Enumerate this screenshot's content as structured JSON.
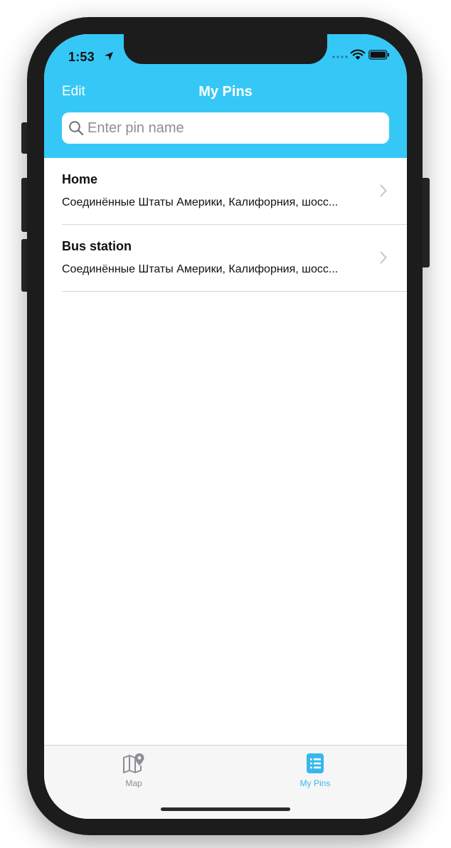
{
  "status_bar": {
    "time": "1:53",
    "location_icon": "location-arrow-icon",
    "wifi_icon": "wifi-icon",
    "battery_icon": "battery-icon"
  },
  "nav": {
    "edit_label": "Edit",
    "title": "My Pins"
  },
  "search": {
    "placeholder": "Enter pin name",
    "value": "",
    "icon": "search-icon"
  },
  "pins": [
    {
      "title": "Home",
      "address": "Соединённые Штаты Америки, Калифорния, шосс..."
    },
    {
      "title": "Bus station",
      "address": "Соединённые Штаты Америки, Калифорния, шосс..."
    }
  ],
  "tab_bar": {
    "tabs": [
      {
        "label": "Map",
        "icon": "map-pin-icon",
        "selected": false
      },
      {
        "label": "My Pins",
        "icon": "list-icon",
        "selected": true
      }
    ]
  },
  "colors": {
    "accent": "#35c8f6",
    "tab_selected": "#35b8ec",
    "tab_unselected": "#8e8e93"
  }
}
